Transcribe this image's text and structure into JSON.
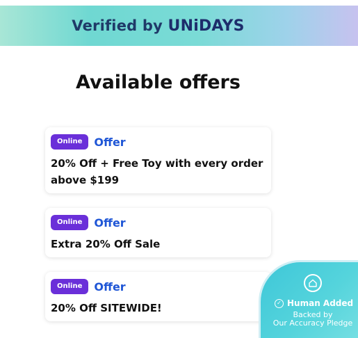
{
  "banner": {
    "prefix": "Verified by ",
    "brand": "UNiDAYS"
  },
  "heading": "Available offers",
  "offers": [
    {
      "badge": "Online",
      "label": "Offer",
      "description": "20% Off + Free Toy with every order above $199"
    },
    {
      "badge": "Online",
      "label": "Offer",
      "description": "Extra 20% Off Sale"
    },
    {
      "badge": "Online",
      "label": "Offer",
      "description": "20% Off SITEWIDE!"
    }
  ],
  "pledge": {
    "title": "Human Added",
    "line1": "Backed by",
    "line2": "Our Accuracy Pledge",
    "icon": "house-shield-icon"
  },
  "colors": {
    "badge_bg": "#6a2fd9",
    "offer_link": "#1f56d6",
    "banner_text": "#1f3a68",
    "pledge_bg": "#3ec7d8"
  }
}
